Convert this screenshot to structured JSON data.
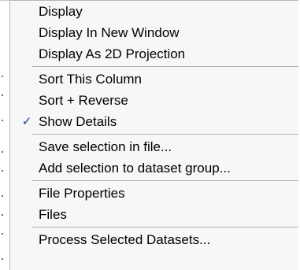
{
  "menu": {
    "groups": [
      {
        "items": [
          {
            "label": "Display"
          },
          {
            "label": "Display In New Window"
          },
          {
            "label": "Display As 2D Projection"
          }
        ]
      },
      {
        "items": [
          {
            "label": "Sort This Column"
          },
          {
            "label": "Sort + Reverse"
          },
          {
            "label": "Show Details",
            "checked": true,
            "check_glyph": "✓"
          }
        ]
      },
      {
        "items": [
          {
            "label": "Save selection in file..."
          },
          {
            "label": "Add selection to dataset group..."
          }
        ]
      },
      {
        "items": [
          {
            "label": "File Properties"
          },
          {
            "label": "Files"
          }
        ]
      },
      {
        "items": [
          {
            "label": "Process Selected Datasets..."
          }
        ]
      }
    ]
  },
  "colors": {
    "menu_background": "#f7f7f7",
    "separator": "#b0b0b0",
    "checkmark": "#1a3f9a"
  },
  "icons": {
    "check": "checkmark-icon"
  }
}
